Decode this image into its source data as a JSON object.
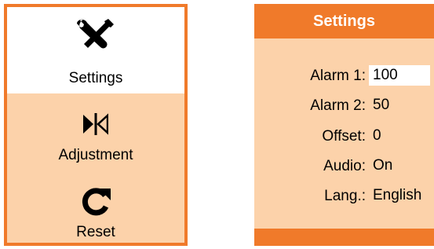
{
  "menu": {
    "items": [
      {
        "label": "Settings",
        "icon": "tools-icon",
        "selected": true
      },
      {
        "label": "Adjustment",
        "icon": "adjust-icon",
        "selected": false
      },
      {
        "label": "Reset",
        "icon": "reset-icon",
        "selected": false
      }
    ]
  },
  "settings": {
    "title": "Settings",
    "rows": [
      {
        "label": "Alarm 1:",
        "value": "100"
      },
      {
        "label": "Alarm 2:",
        "value": "50"
      },
      {
        "label": "Offset:",
        "value": "0"
      },
      {
        "label": "Audio:",
        "value": "On"
      },
      {
        "label": "Lang.:",
        "value": "English"
      }
    ]
  },
  "colors": {
    "accent": "#F07A2A",
    "panel_bg": "#FCD2AA",
    "selected_bg": "#FFFFFF"
  }
}
